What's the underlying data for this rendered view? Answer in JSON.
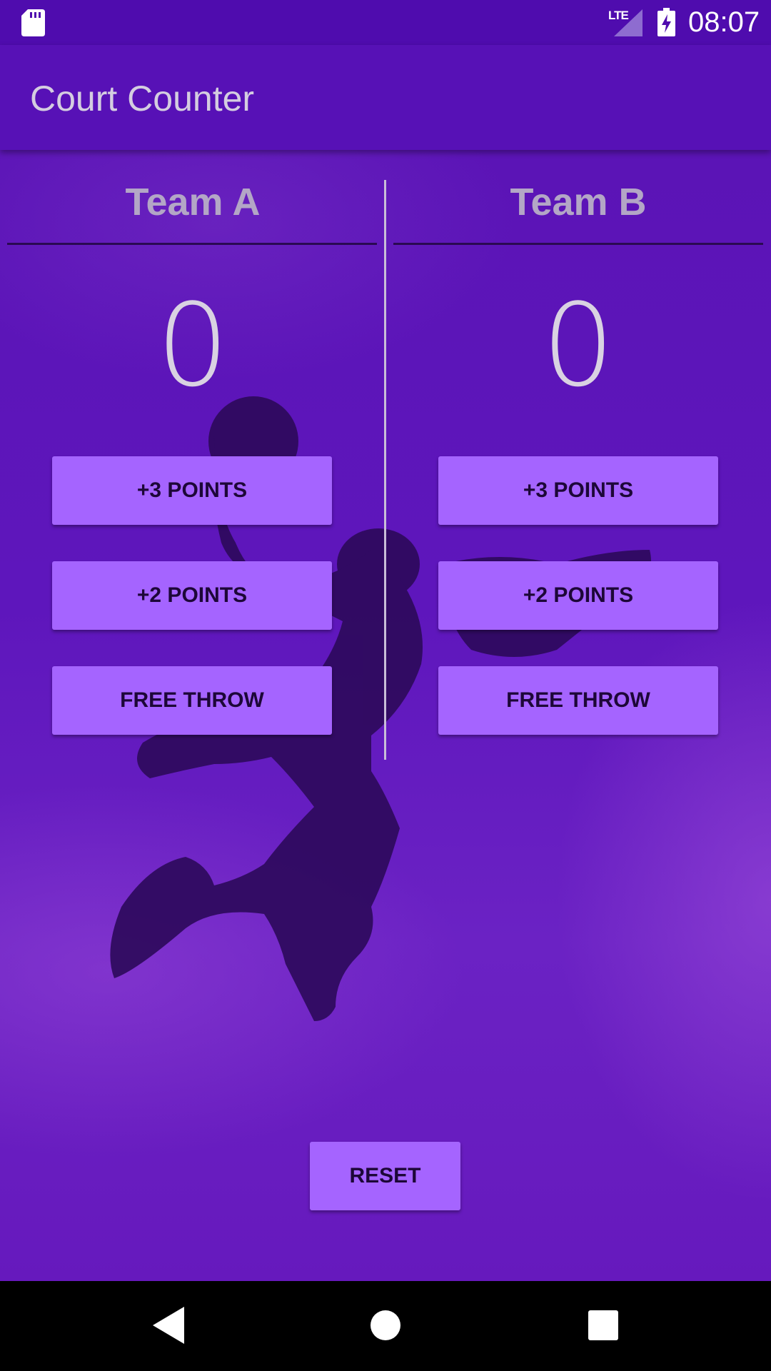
{
  "status_bar": {
    "network_label": "LTE",
    "time": "08:07",
    "icons": [
      "sd-card-icon",
      "signal-icon",
      "battery-charging-icon"
    ]
  },
  "app_bar": {
    "title": "Court Counter"
  },
  "team_a": {
    "name": "Team A",
    "score": "0",
    "buttons": {
      "plus_three": "+3 POINTS",
      "plus_two": "+2 POINTS",
      "free_throw": "FREE THROW"
    }
  },
  "team_b": {
    "name": "Team B",
    "score": "0",
    "buttons": {
      "plus_three": "+3 POINTS",
      "plus_two": "+2 POINTS",
      "free_throw": "FREE THROW"
    }
  },
  "reset_label": "RESET",
  "nav_bar": {
    "icons": [
      "back-icon",
      "home-icon",
      "recents-icon"
    ]
  },
  "colors": {
    "primary": "#5711b6",
    "accent_button": "#a564ff",
    "background": "#5e16bc"
  }
}
